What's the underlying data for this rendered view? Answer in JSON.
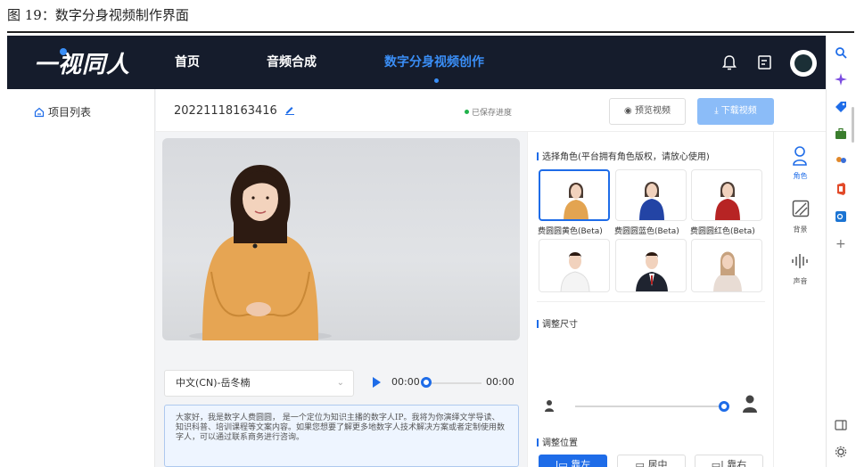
{
  "caption": "图 19：数字分身视频制作界面",
  "topbar": {
    "logo": "一视同人",
    "nav": [
      "首页",
      "音频合成",
      "数字分身视频创作"
    ],
    "active_nav": "数字分身视频创作"
  },
  "leftnav": {
    "project_list": "项目列表"
  },
  "header": {
    "project_id": "20221118163416",
    "saved_status": "已保存进度",
    "preview_label": "预览视频",
    "download_label": "下载视频"
  },
  "voice": {
    "selected": "中文(CN)-岳冬楠",
    "time_current": "00:00",
    "time_total": "00:00",
    "progress": 0
  },
  "script_text": "大家好，我是数字人费圆圆， 是一个定位为知识主播的数字人IP。我将为你演绎文学导读、知识科普、培训课程等文案内容。如果您想要了解更多地数字人技术解决方案或者定制使用数字人，可以通过联系商务进行咨询。",
  "roles": {
    "title": "选择角色(平台拥有角色版权，请放心使用)",
    "items": [
      {
        "name": "费圆圆黄色(Beta)",
        "color": "#e3a451",
        "selected": true
      },
      {
        "name": "费圆圆蓝色(Beta)",
        "color": "#2344a5",
        "selected": false
      },
      {
        "name": "费圆圆红色(Beta)",
        "color": "#b72424",
        "selected": false
      },
      {
        "name": "",
        "color": "#f4f4f4",
        "selected": false
      },
      {
        "name": "",
        "color": "#1f2430",
        "selected": false
      },
      {
        "name": "",
        "color": "#e8dcd4",
        "selected": false
      }
    ]
  },
  "size": {
    "title": "调整尺寸",
    "value": 1.0
  },
  "position": {
    "title": "调整位置",
    "options": [
      "靠左",
      "居中",
      "靠右"
    ],
    "active": "靠左"
  },
  "tabs": [
    {
      "label": "角色",
      "icon": "person-icon",
      "active": true
    },
    {
      "label": "背景",
      "icon": "background-icon",
      "active": false
    },
    {
      "label": "声音",
      "icon": "sound-wave-icon",
      "active": false
    }
  ],
  "colors": {
    "accent": "#1e6ce8",
    "topbar": "#151c2c"
  }
}
